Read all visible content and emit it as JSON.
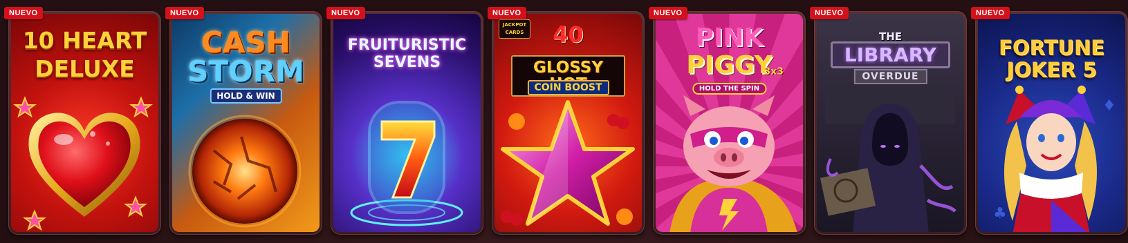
{
  "badge_label": "NUEVO",
  "games": [
    {
      "title_lines": [
        "10 HEART",
        "DELUXE"
      ],
      "subtitle": "",
      "theme": "heart"
    },
    {
      "title_lines": [
        "CASH",
        "STORM"
      ],
      "subtitle": "HOLD & WIN",
      "theme": "storm"
    },
    {
      "title_lines": [
        "FRUITURISTIC",
        "SEVENS"
      ],
      "subtitle": "",
      "theme": "seven"
    },
    {
      "title_lines": [
        "40",
        "GLOSSY HOT"
      ],
      "subtitle": "COIN BOOST",
      "brand": "JACKPOT CARDS",
      "theme": "star"
    },
    {
      "title_lines": [
        "PINK",
        "PIGGY"
      ],
      "subtitle": "HOLD THE SPIN",
      "tag": "3x3",
      "theme": "pig"
    },
    {
      "title_lines": [
        "THE",
        "LIBRARY"
      ],
      "subtitle": "OVERDUE",
      "theme": "library"
    },
    {
      "title_lines": [
        "FORTUNE",
        "JOKER 5"
      ],
      "subtitle": "",
      "theme": "joker"
    }
  ]
}
